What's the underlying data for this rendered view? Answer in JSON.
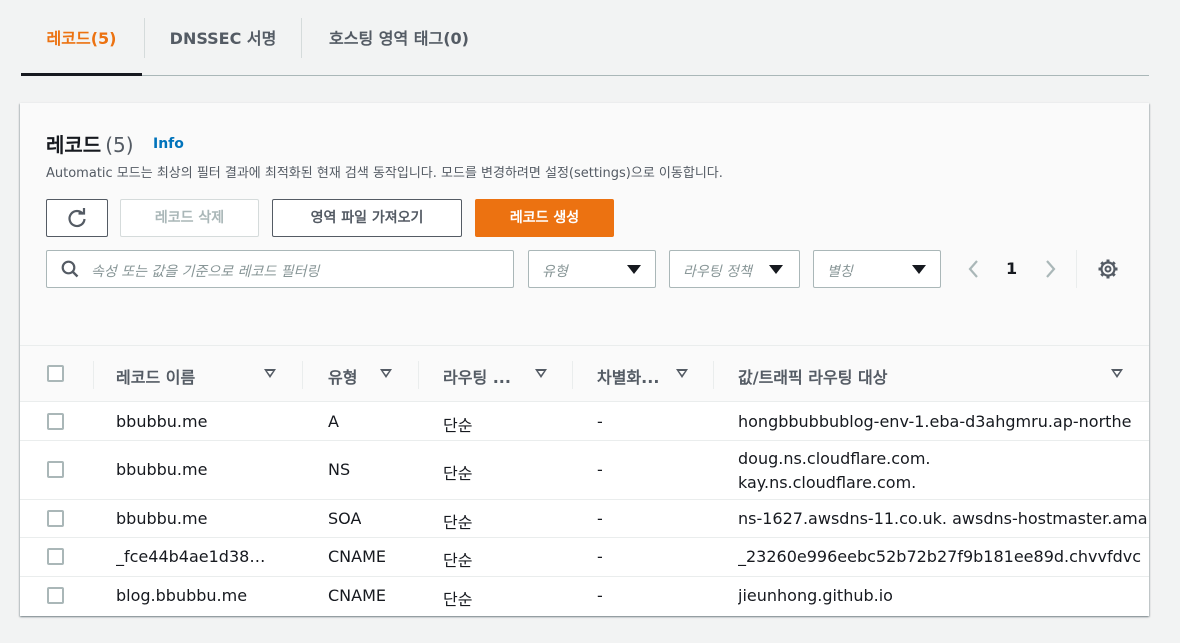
{
  "tabs": [
    {
      "label": "레코드(5)",
      "active": true
    },
    {
      "label": "DNSSEC 서명",
      "active": false
    },
    {
      "label": "호스팅 영역 태그(0)",
      "active": false
    }
  ],
  "panel": {
    "title": "레코드",
    "count": "(5)",
    "info": "Info",
    "description": "Automatic 모드는 최상의 필터 결과에 최적화된 현재 검색 동작입니다. 모드를 변경하려면 설정(settings)으로 이동합니다."
  },
  "toolbar": {
    "refresh_icon": "refresh-icon",
    "delete_label": "레코드 삭제",
    "import_label": "영역 파일 가져오기",
    "create_label": "레코드 생성"
  },
  "filters": {
    "search_placeholder": "속성 또는 값을 기준으로 레코드 필터링",
    "type_placeholder": "유형",
    "routing_placeholder": "라우팅 정책",
    "alias_placeholder": "별칭"
  },
  "pagination": {
    "current_page": "1"
  },
  "columns": [
    "레코드 이름",
    "유형",
    "라우팅 ...",
    "차별화...",
    "값/트래픽 라우팅 대상"
  ],
  "rows": [
    {
      "name": "bbubbu.me",
      "type": "A",
      "routing": "단순",
      "diff": "-",
      "value": [
        "hongbbubbublog-env-1.eba-d3ahgmru.ap-northe"
      ]
    },
    {
      "name": "bbubbu.me",
      "type": "NS",
      "routing": "단순",
      "diff": "-",
      "value": [
        "doug.ns.cloudflare.com.",
        "kay.ns.cloudflare.com."
      ]
    },
    {
      "name": "bbubbu.me",
      "type": "SOA",
      "routing": "단순",
      "diff": "-",
      "value": [
        "ns-1627.awsdns-11.co.uk. awsdns-hostmaster.ama"
      ]
    },
    {
      "name": "_fce44b4ae1d38…",
      "type": "CNAME",
      "routing": "단순",
      "diff": "-",
      "value": [
        "_23260e996eebc52b72b27f9b181ee89d.chvvfdvc"
      ]
    },
    {
      "name": "blog.bbubbu.me",
      "type": "CNAME",
      "routing": "단순",
      "diff": "-",
      "value": [
        "jieunhong.github.io"
      ]
    }
  ],
  "colors": {
    "accent": "#ec7211",
    "link": "#0073bb",
    "text": "#16191f",
    "muted": "#545b64",
    "border": "#aab7b8"
  }
}
